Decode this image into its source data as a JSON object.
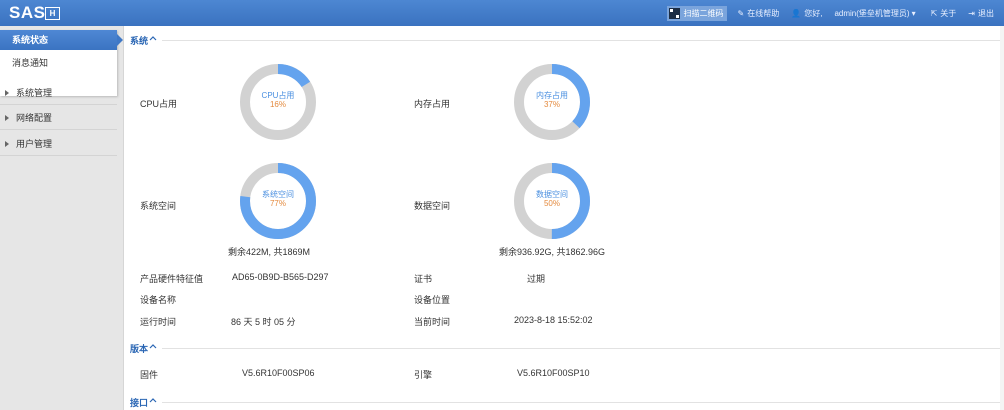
{
  "topbar": {
    "logo": "SAS",
    "logo_badge": "H",
    "scan_label": "扫描二维码",
    "help_label": "在线帮助",
    "greeting": "您好,",
    "user": "admin(堡垒机管理员)",
    "about_label": "关于",
    "logout_label": "退出"
  },
  "sidebar": {
    "sub_items": [
      "系统状态",
      "消息通知"
    ],
    "menus": [
      "系统管理",
      "网络配置",
      "用户管理"
    ]
  },
  "sections": {
    "system": "系统",
    "version": "版本",
    "interface": "接口"
  },
  "charts": {
    "cpu": {
      "label": "CPU占用",
      "name": "CPU占用",
      "percent": 16,
      "percent_text": "16%"
    },
    "mem": {
      "label": "内存占用",
      "name": "内存占用",
      "percent": 37,
      "percent_text": "37%"
    },
    "sys": {
      "label": "系统空间",
      "name": "系统空间",
      "percent": 77,
      "percent_text": "77%",
      "caption": "剩余422M, 共1869M"
    },
    "data": {
      "label": "数据空间",
      "name": "数据空间",
      "percent": 50,
      "percent_text": "50%",
      "caption": "剩余936.92G, 共1862.96G"
    }
  },
  "info": {
    "hw_label": "产品硬件特征值",
    "hw_value": "AD65-0B9D-B565-D297",
    "cert_label": "证书",
    "cert_value": "过期",
    "dev_name_label": "设备名称",
    "dev_name_value": "",
    "dev_loc_label": "设备位置",
    "dev_loc_value": "",
    "uptime_label": "运行时间",
    "uptime_value": "86 天 5 时 05 分",
    "now_label": "当前时间",
    "now_value": "2023-8-18 15:52:02"
  },
  "version": {
    "fw_label": "固件",
    "fw_value": "V5.6R10F00SP06",
    "engine_label": "引擎",
    "engine_value": "V5.6R10F00SP10"
  },
  "colors": {
    "accent": "#3b74c2",
    "ring_fill": "#64a3ee",
    "ring_track": "#d2d2d2",
    "percent": "#e48a3e"
  }
}
